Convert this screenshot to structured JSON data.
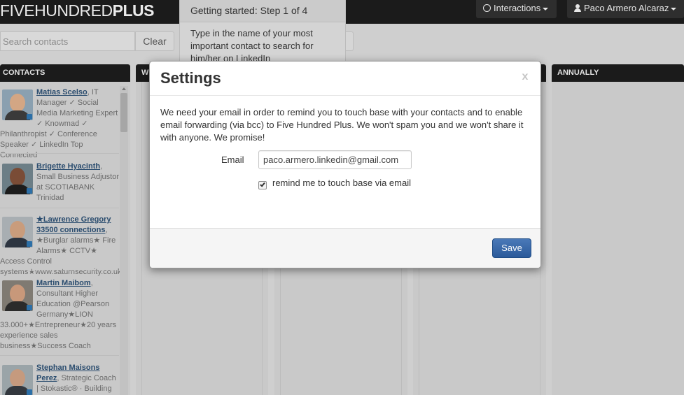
{
  "app": {
    "logo_light": "FIVEHUNDRED",
    "logo_bold": "PLUS"
  },
  "nav": {
    "interactions_label": "Interactions",
    "user_label": "Paco Armero Alcaraz"
  },
  "search": {
    "placeholder": "Search contacts",
    "clear_label": "Clear"
  },
  "tour": {
    "title": "Getting started: Step 1 of 4",
    "body": "Type in the name of your most important contact to search for him/her on LinkedIn"
  },
  "columns": {
    "contacts": "CONTACTS",
    "w": "W",
    "annually": "ANNUALLY"
  },
  "contacts": [
    {
      "name": "Matias Scelso",
      "headline": ", IT Manager ✓ Social Media Marketing Expert ✓ Knowmad ✓ Philanthropist ✓ Conference Speaker ✓ LinkedIn Top Connected"
    },
    {
      "name": "Brigette Hyacinth",
      "headline": ", Small Business Adjustor at SCOTIABANK Trinidad"
    },
    {
      "name": "★Lawrence Gregory 33500 connections",
      "headline": ", ★Burglar alarms★ Fire Alarms★ CCTV★ Access Control systems★www.saturnsecurity.co.uk"
    },
    {
      "name": "Martin Maibom",
      "headline": ", Consultant Higher Education @Pearson Germany★LION 33.000+★Entrepreneur★20 years experience sales business★Success Coach"
    },
    {
      "name": "Stephan Maisons Perez",
      "headline": ", Strategic Coach | Stokastic® · Building"
    }
  ],
  "modal": {
    "title": "Settings",
    "close": "x",
    "body": "We need your email in order to remind you to touch base with your contacts and to enable email forwarding (via bcc) to Five Hundred Plus. We won't spam you and we won't share it with anyone. We promise!",
    "email_label": "Email",
    "email_value": "paco.armero.linkedin@gmail.com",
    "remind_checked": true,
    "remind_label": "remind me to touch base via email",
    "save_label": "Save"
  },
  "colors": {
    "topbar": "#1b1b1b",
    "overlay_background": "#cfcfcf",
    "link": "#2a4c6e",
    "primary_button": "#2b5a9a"
  },
  "icons": {
    "interactions": "globe-icon",
    "user": "user-icon",
    "dropdown": "caret-down-icon",
    "close": "close-icon",
    "linkedin": "linkedin-badge-icon"
  }
}
